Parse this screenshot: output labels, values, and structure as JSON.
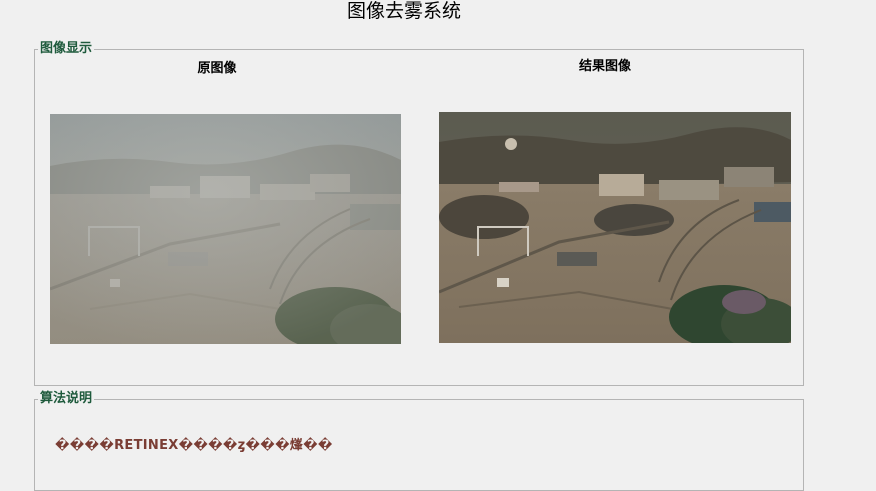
{
  "window": {
    "title": "图像去雾系统"
  },
  "image_panel": {
    "legend": "图像显示",
    "original": {
      "caption": "原图像"
    },
    "result": {
      "caption": "结果图像"
    }
  },
  "algorithm_panel": {
    "legend": "算法说明",
    "description": "����RETINEX����ȥ���㷨��"
  },
  "colors": {
    "legend_green": "#1e5a3c",
    "description_brown": "#7a3d34",
    "background": "#f0f0f0",
    "border": "#b4b4b4"
  }
}
